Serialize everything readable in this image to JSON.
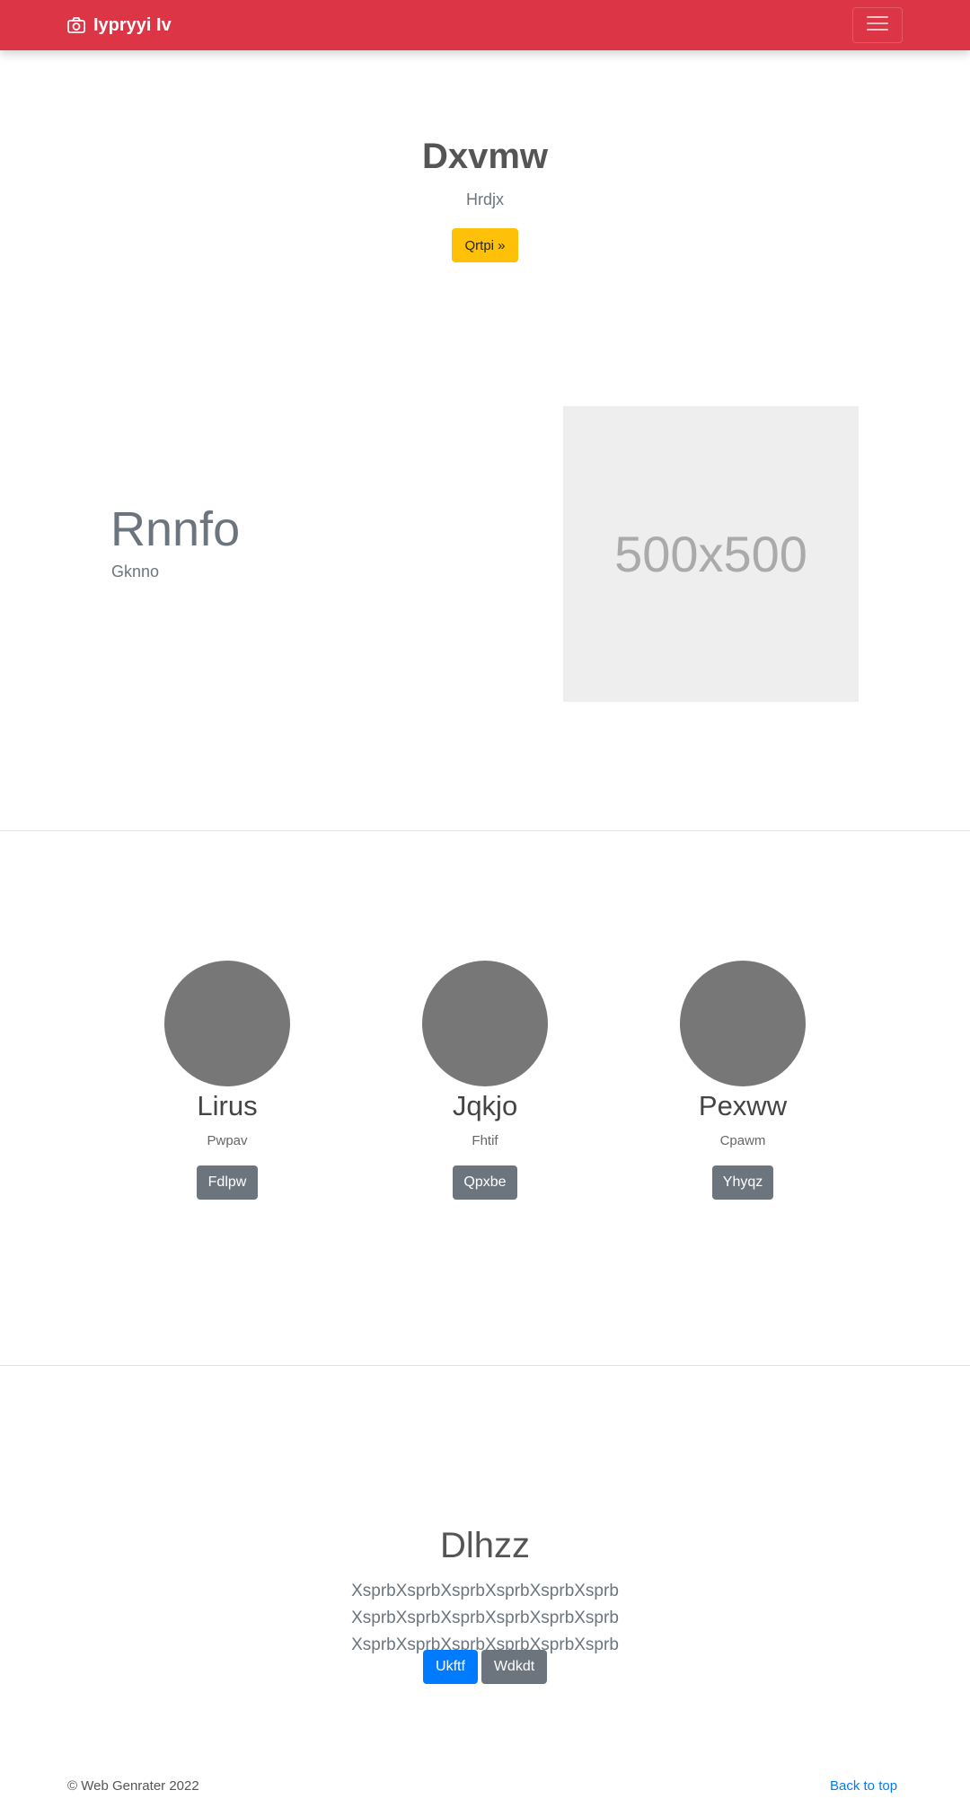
{
  "navbar": {
    "brand_icon": "camera-icon",
    "brand_text": "Iypryyi Iv",
    "toggler_icon": "hamburger-menu-icon",
    "background": "#dc3545"
  },
  "hero": {
    "title": "Dxvmw",
    "subtitle": "Hrdjx",
    "button_label": "Qrtpi »"
  },
  "feature": {
    "title": "Rnnfo",
    "subtitle": "Gknno",
    "image_placeholder_text": "500x500"
  },
  "team": [
    {
      "name": "Lirus",
      "role": "Pwpav",
      "button_label": "Fdlpw"
    },
    {
      "name": "Jqkjo",
      "role": "Fhtif",
      "button_label": "Qpxbe"
    },
    {
      "name": "Pexww",
      "role": "Cpawm",
      "button_label": "Yhyqz"
    }
  ],
  "cta": {
    "title": "Dlhzz",
    "text": "XsprbXsprbXsprbXsprbXsprbXsprb XsprbXsprbXsprbXsprbXsprbXsprb XsprbXsprbXsprbXsprbXsprbXsprb",
    "primary_button": "Ukftf",
    "secondary_button": "Wdkdt"
  },
  "footer": {
    "copyright": "© Web Genrater 2022",
    "back_to_top": "Back to top"
  },
  "colors": {
    "danger": "#dc3545",
    "warning": "#ffc107",
    "secondary": "#6c757d",
    "primary": "#007bff"
  }
}
